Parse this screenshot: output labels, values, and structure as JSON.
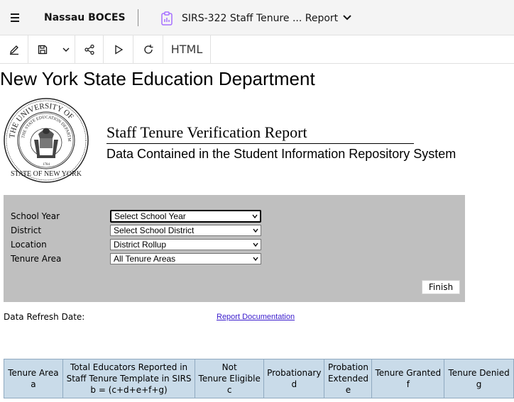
{
  "header": {
    "menu_icon": "hamburger-menu-icon",
    "org_name": "Nassau BOCES",
    "report_icon": "report-clipboard-icon",
    "report_name": "SIRS-322 Staff Tenure ... Report",
    "dropdown_icon": "chevron-down-icon"
  },
  "toolbar": {
    "edit_icon": "pencil-icon",
    "save_icon": "save-icon",
    "save_menu_icon": "chevron-down-icon",
    "share_icon": "share-icon",
    "run_icon": "play-icon",
    "refresh_icon": "refresh-icon",
    "format_label": "HTML"
  },
  "report": {
    "department": "New York State Education Department",
    "title": "Staff Tenure Verification Report",
    "subtitle": "Data Contained in the Student Information Repository System"
  },
  "seal": {
    "outer_text": "THE UNIVERSITY OF THE STATE OF NEW YORK",
    "inner_text": "THE STATE EDUCATION DEPARTMENT",
    "year": "1784"
  },
  "parameters": {
    "school_year_label": "School Year",
    "school_year_value": "Select School Year",
    "district_label": "District",
    "district_value": "Select School District",
    "location_label": "Location",
    "location_value": "District Rollup",
    "tenure_area_label": "Tenure Area",
    "tenure_area_value": "All Tenure Areas",
    "finish_label": "Finish"
  },
  "footer": {
    "refresh_label": "Data Refresh Date:",
    "doc_link": "Report Documentation"
  },
  "table": {
    "headers": [
      {
        "lines": [
          "Tenure Area",
          "a"
        ]
      },
      {
        "lines": [
          "Total Educators Reported in",
          "Staff Tenure Template in SIRS",
          "b = (c+d+e+f+g)"
        ]
      },
      {
        "lines": [
          "Not",
          "Tenure Eligible",
          "c"
        ]
      },
      {
        "lines": [
          "Probationary",
          "d"
        ]
      },
      {
        "lines": [
          "Probation",
          "Extended",
          "e"
        ]
      },
      {
        "lines": [
          "Tenure Granted",
          "f"
        ]
      },
      {
        "lines": [
          "Tenure Denied",
          "g"
        ]
      }
    ]
  }
}
